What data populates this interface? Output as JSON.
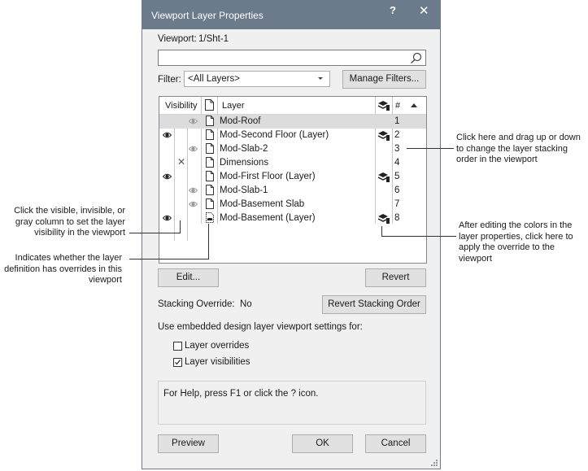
{
  "dialog": {
    "title": "Viewport Layer Properties",
    "help_label": "?",
    "close_label": "✕"
  },
  "viewport": {
    "label": "Viewport:",
    "value": "1/Sht-1"
  },
  "search": {
    "value": "",
    "placeholder": ""
  },
  "filter": {
    "label": "Filter:",
    "selected": "<All Layers>",
    "manage_label": "Manage Filters..."
  },
  "table": {
    "headers": {
      "visibility": "Visibility",
      "layer": "Layer",
      "number": "#"
    },
    "rows": [
      {
        "name": "Mod-Roof",
        "number": "1",
        "visibility": "gray",
        "stack_override": false,
        "selected": true
      },
      {
        "name": "Mod-Second Floor (Layer)",
        "number": "2",
        "visibility": "visible",
        "stack_override": true,
        "selected": false
      },
      {
        "name": "Mod-Slab-2",
        "number": "3",
        "visibility": "gray",
        "stack_override": false,
        "selected": false
      },
      {
        "name": "Dimensions",
        "number": "4",
        "visibility": "invisible",
        "stack_override": false,
        "selected": false
      },
      {
        "name": "Mod-First Floor (Layer)",
        "number": "5",
        "visibility": "visible",
        "stack_override": true,
        "selected": false
      },
      {
        "name": "Mod-Slab-1",
        "number": "6",
        "visibility": "gray",
        "stack_override": false,
        "selected": false
      },
      {
        "name": "Mod-Basement Slab",
        "number": "7",
        "visibility": "gray",
        "stack_override": false,
        "selected": false
      },
      {
        "name": "Mod-Basement (Layer)",
        "number": "8",
        "visibility": "visible",
        "stack_override": true,
        "selected": false,
        "has_overrides": true
      }
    ]
  },
  "buttons": {
    "edit": "Edit...",
    "revert": "Revert",
    "revert_stacking": "Revert Stacking Order",
    "preview": "Preview",
    "ok": "OK",
    "cancel": "Cancel"
  },
  "stacking": {
    "label": "Stacking Override:",
    "value": "No"
  },
  "embedded": {
    "label": "Use embedded design layer viewport settings for:",
    "options": [
      {
        "label": "Layer overrides",
        "checked": false
      },
      {
        "label": "Layer visibilities",
        "checked": true
      }
    ]
  },
  "help_text": "For Help, press F1 or click the ? icon.",
  "annotations": {
    "stacking_order": "Click here and drag up or down to change the layer stacking order in the viewport",
    "visibility": "Click the visible, invisible, or gray column to set the layer visibility in the viewport",
    "overrides": "Indicates whether the layer definition has overrides in this viewport",
    "apply_override": "After editing the colors in the layer properties, click here to apply the override to the viewport"
  },
  "colors": {
    "titlebar": "#6c7b8b",
    "dialog_bg": "#f0f0f0",
    "selected_row": "#dcdcdc"
  }
}
